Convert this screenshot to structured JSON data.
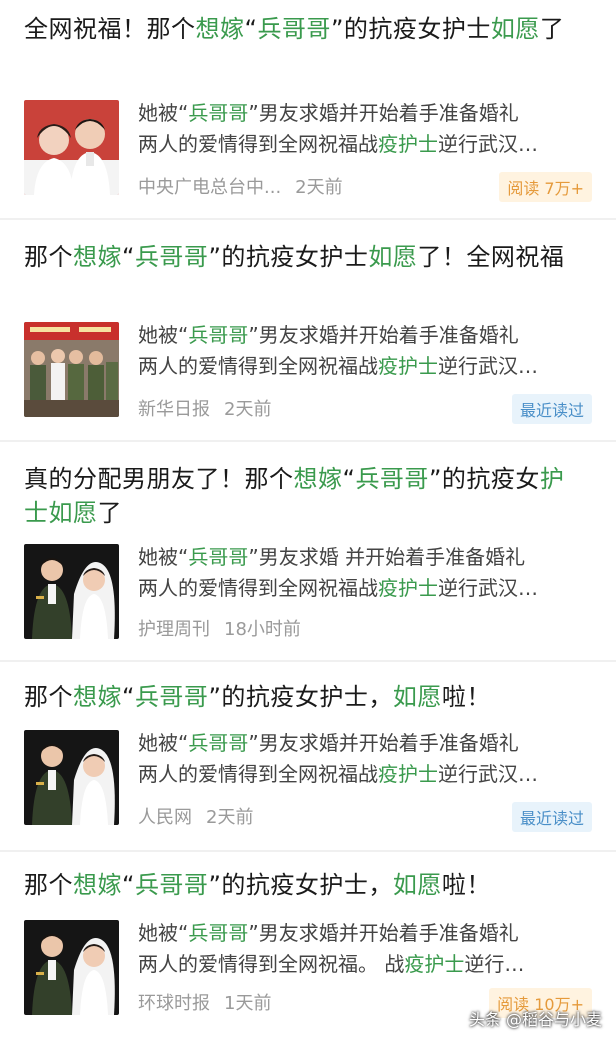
{
  "items": [
    {
      "title_parts": [
        {
          "t": "全网祝福！那个",
          "h": false
        },
        {
          "t": "想嫁",
          "h": true
        },
        {
          "t": "“",
          "h": false
        },
        {
          "t": "兵哥哥",
          "h": true
        },
        {
          "t": "”的抗疫女护士",
          "h": false
        },
        {
          "t": "如愿",
          "h": true
        },
        {
          "t": "了",
          "h": false
        }
      ],
      "snippet_line1_parts": [
        {
          "t": "她被“",
          "h": false
        },
        {
          "t": "兵哥哥",
          "h": true
        },
        {
          "t": "”男友求婚并开始着手准备婚礼",
          "h": false
        }
      ],
      "snippet_line2_parts": [
        {
          "t": "两人的爱情得到全网祝福战",
          "h": false
        },
        {
          "t": "疫护士",
          "h": true
        },
        {
          "t": "逆行武汉…",
          "h": false
        }
      ],
      "source": "中央广电总台中...",
      "time": "2天前",
      "badge": "阅读 7万+",
      "badge_type": "read",
      "thumb_icon": "couple-nurse-photo-icon"
    },
    {
      "title_parts": [
        {
          "t": "那个",
          "h": false
        },
        {
          "t": "想嫁",
          "h": true
        },
        {
          "t": "“",
          "h": false
        },
        {
          "t": "兵哥哥",
          "h": true
        },
        {
          "t": "”的抗疫女护士",
          "h": false
        },
        {
          "t": "如愿",
          "h": true
        },
        {
          "t": "了！全网祝福",
          "h": false
        }
      ],
      "snippet_line1_parts": [
        {
          "t": "她被“",
          "h": false
        },
        {
          "t": "兵哥哥",
          "h": true
        },
        {
          "t": "”男友求婚并开始着手准备婚礼",
          "h": false
        }
      ],
      "snippet_line2_parts": [
        {
          "t": "两人的爱情得到全网祝福战",
          "h": false
        },
        {
          "t": "疫护士",
          "h": true
        },
        {
          "t": "逆行武汉…",
          "h": false
        }
      ],
      "source": "新华日报",
      "time": "2天前",
      "badge": "最近读过",
      "badge_type": "recent",
      "thumb_icon": "soldiers-group-photo-icon"
    },
    {
      "title_parts": [
        {
          "t": "真的分配男朋友了！那个",
          "h": false
        },
        {
          "t": "想嫁",
          "h": true
        },
        {
          "t": "“",
          "h": false
        },
        {
          "t": "兵哥哥",
          "h": true
        },
        {
          "t": "”的抗疫女",
          "h": false
        },
        {
          "t": "护士如愿",
          "h": true
        },
        {
          "t": "了",
          "h": false
        }
      ],
      "snippet_line1_parts": [
        {
          "t": "她被“",
          "h": false
        },
        {
          "t": "兵哥哥",
          "h": true
        },
        {
          "t": "”男友求婚 并开始着手准备婚礼",
          "h": false
        }
      ],
      "snippet_line2_parts": [
        {
          "t": "两人的爱情得到全网祝福战",
          "h": false
        },
        {
          "t": "疫护士",
          "h": true
        },
        {
          "t": "逆行武汉…",
          "h": false
        }
      ],
      "source": "护理周刊",
      "time": "18小时前",
      "badge": "",
      "badge_type": "",
      "thumb_icon": "wedding-photo-icon"
    },
    {
      "title_parts": [
        {
          "t": "那个",
          "h": false
        },
        {
          "t": "想嫁",
          "h": true
        },
        {
          "t": "“",
          "h": false
        },
        {
          "t": "兵哥哥",
          "h": true
        },
        {
          "t": "”的抗疫女护士，",
          "h": false
        },
        {
          "t": "如愿",
          "h": true
        },
        {
          "t": "啦！",
          "h": false
        }
      ],
      "snippet_line1_parts": [
        {
          "t": "她被“",
          "h": false
        },
        {
          "t": "兵哥哥",
          "h": true
        },
        {
          "t": "”男友求婚并开始着手准备婚礼",
          "h": false
        }
      ],
      "snippet_line2_parts": [
        {
          "t": "两人的爱情得到全网祝福战",
          "h": false
        },
        {
          "t": "疫护士",
          "h": true
        },
        {
          "t": "逆行武汉…",
          "h": false
        }
      ],
      "source": "人民网",
      "time": "2天前",
      "badge": "最近读过",
      "badge_type": "recent",
      "thumb_icon": "wedding-photo-icon"
    },
    {
      "title_parts": [
        {
          "t": "那个",
          "h": false
        },
        {
          "t": "想嫁",
          "h": true
        },
        {
          "t": "“",
          "h": false
        },
        {
          "t": "兵哥哥",
          "h": true
        },
        {
          "t": "”的抗疫女护士，",
          "h": false
        },
        {
          "t": "如愿",
          "h": true
        },
        {
          "t": "啦！",
          "h": false
        }
      ],
      "snippet_line1_parts": [
        {
          "t": "她被“",
          "h": false
        },
        {
          "t": "兵哥哥",
          "h": true
        },
        {
          "t": "”男友求婚并开始着手准备婚礼",
          "h": false
        }
      ],
      "snippet_line2_parts": [
        {
          "t": "两人的爱情得到全网祝福。 战",
          "h": false
        },
        {
          "t": "疫护士",
          "h": true
        },
        {
          "t": "逆行…",
          "h": false
        }
      ],
      "source": "环球时报",
      "time": "1天前",
      "badge": "阅读 10万+",
      "badge_type": "read",
      "thumb_icon": "wedding-photo-icon"
    }
  ],
  "watermark": "头条 @稻谷与小麦",
  "colors": {
    "highlight": "#3a9a4d",
    "read_badge_bg": "#fff3e0",
    "read_badge_fg": "#e59a3b",
    "recent_badge_bg": "#e8f3fb",
    "recent_badge_fg": "#4a8fc8"
  }
}
